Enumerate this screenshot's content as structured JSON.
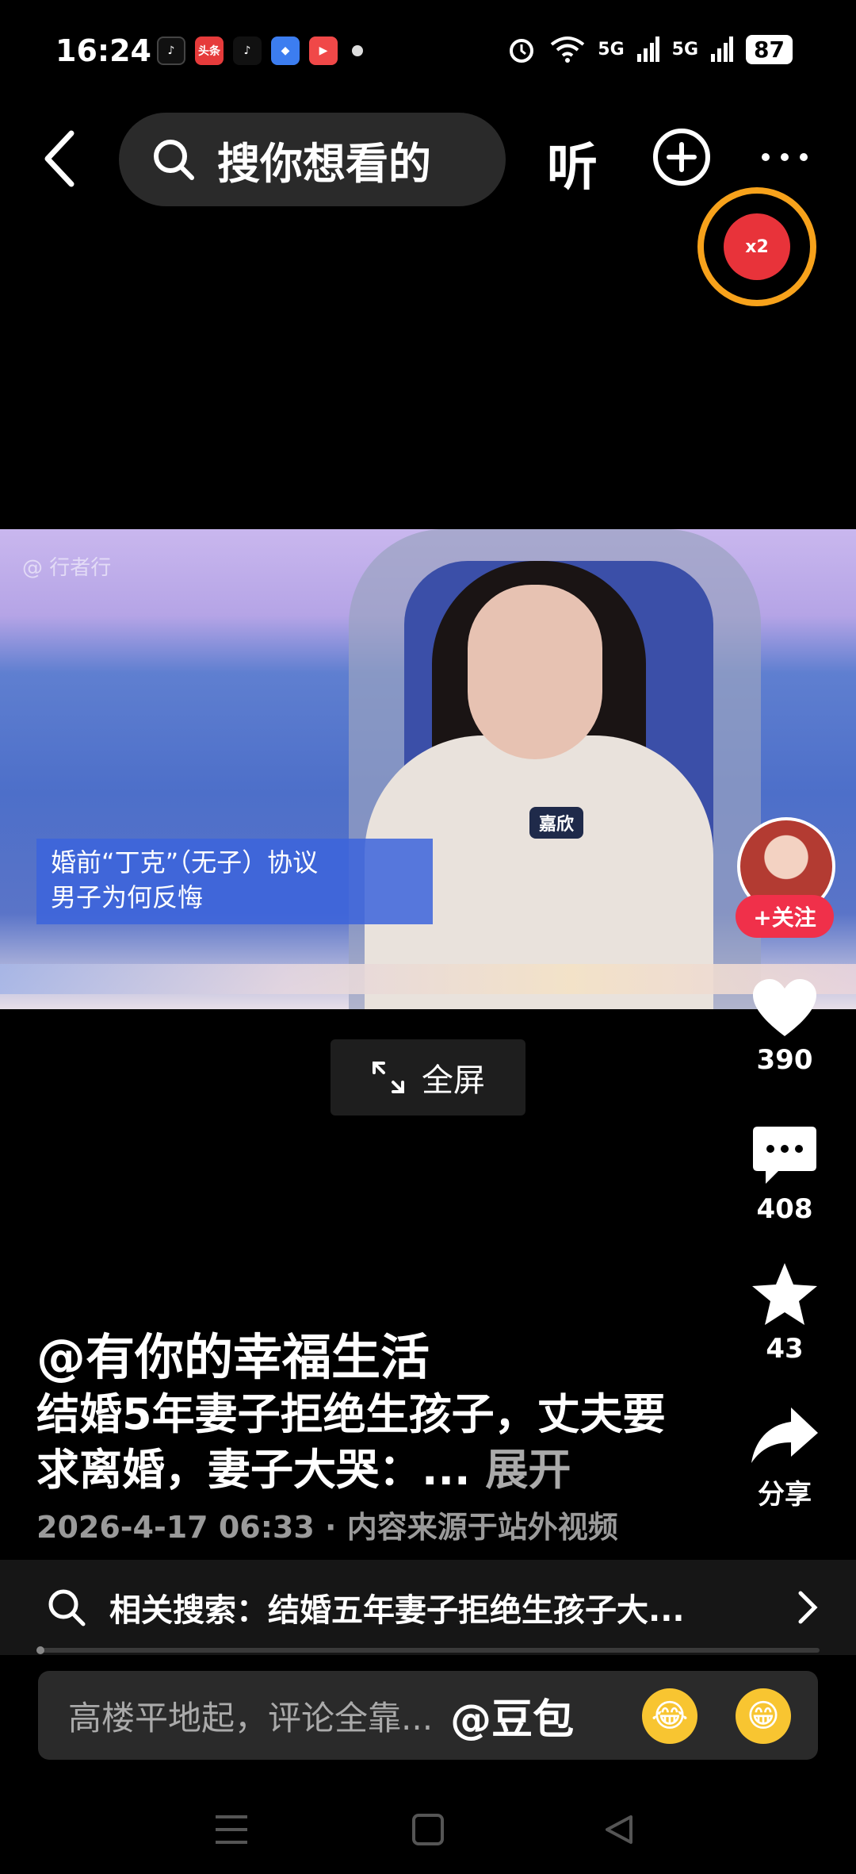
{
  "status": {
    "time": "16:24",
    "notif_apps": [
      "douyin",
      "toutiao",
      "tiktok",
      "browser",
      "video"
    ],
    "toutiao_label": "头条",
    "signal_1": "5G",
    "signal_2": "5G",
    "battery": "87"
  },
  "topbar": {
    "search_placeholder": "搜你想看的",
    "listen_label": "听",
    "redpack_label": "x2"
  },
  "video": {
    "watermark": "@ 行者行",
    "name_badge": "嘉欣",
    "subtitle_line1": "婚前“丁克”（无子）协议",
    "subtitle_line2": "男子为何反悔"
  },
  "rail": {
    "follow_label": "+关注",
    "likes": "390",
    "comments": "408",
    "favorites": "43",
    "share_label": "分享"
  },
  "fullscreen_label": "全屏",
  "post": {
    "author": "@有你的幸福生活",
    "description": "结婚5年妻子拒绝生孩子，丈夫要求离婚，妻子大哭：...",
    "expand": "展开",
    "meta": "2026-4-17 06:33 · 内容来源于站外视频"
  },
  "related": {
    "text": "相关搜索：结婚五年妻子拒绝生孩子大..."
  },
  "comment_bar": {
    "placeholder": "高楼平地起，评论全靠...",
    "mention": "@豆包"
  },
  "colors": {
    "accent_red": "#f0304a",
    "redpack_ring": "#f7a21b"
  }
}
